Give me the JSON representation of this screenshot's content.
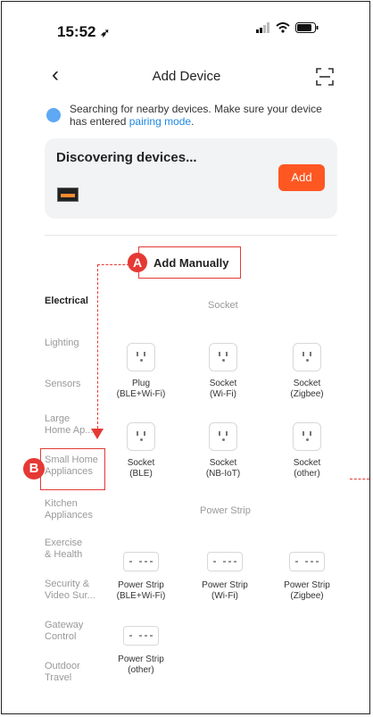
{
  "status_bar": {
    "time": "15:52"
  },
  "nav": {
    "back": "‹",
    "title": "Add Device"
  },
  "hint": {
    "text": "Searching for nearby devices. Make sure your device has entered ",
    "link": "pairing mode",
    "suffix": "."
  },
  "discover": {
    "title": "Discovering devices...",
    "add": "Add"
  },
  "add_manually": "Add Manually",
  "callouts": {
    "a": "A",
    "b": "B"
  },
  "sidebar": [
    {
      "label": "Electrical",
      "active": true
    },
    {
      "label": "Lighting"
    },
    {
      "label": "Sensors"
    },
    {
      "label": "Large\nHome Ap..."
    },
    {
      "label": "Small Home\nAppliances"
    },
    {
      "label": "Kitchen\nAppliances"
    },
    {
      "label": "Exercise\n& Health"
    },
    {
      "label": "Security &\nVideo Sur..."
    },
    {
      "label": "Gateway\nControl"
    },
    {
      "label": "Outdoor\nTravel"
    }
  ],
  "sections": {
    "socket": "Socket",
    "power_strip": "Power Strip"
  },
  "sockets": [
    {
      "l1": "Plug",
      "l2": "(BLE+Wi-Fi)"
    },
    {
      "l1": "Socket",
      "l2": "(Wi-Fi)"
    },
    {
      "l1": "Socket",
      "l2": "(Zigbee)"
    },
    {
      "l1": "Socket",
      "l2": "(BLE)"
    },
    {
      "l1": "Socket",
      "l2": "(NB-IoT)"
    },
    {
      "l1": "Socket",
      "l2": "(other)"
    }
  ],
  "strips": [
    {
      "l1": "Power Strip",
      "l2": "(BLE+Wi-Fi)"
    },
    {
      "l1": "Power Strip",
      "l2": "(Wi-Fi)"
    },
    {
      "l1": "Power Strip",
      "l2": "(Zigbee)"
    },
    {
      "l1": "Power Strip",
      "l2": "(other)"
    }
  ],
  "colors": {
    "accent": "#ff5722",
    "callout": "#e53935",
    "link": "#1e88e5"
  }
}
